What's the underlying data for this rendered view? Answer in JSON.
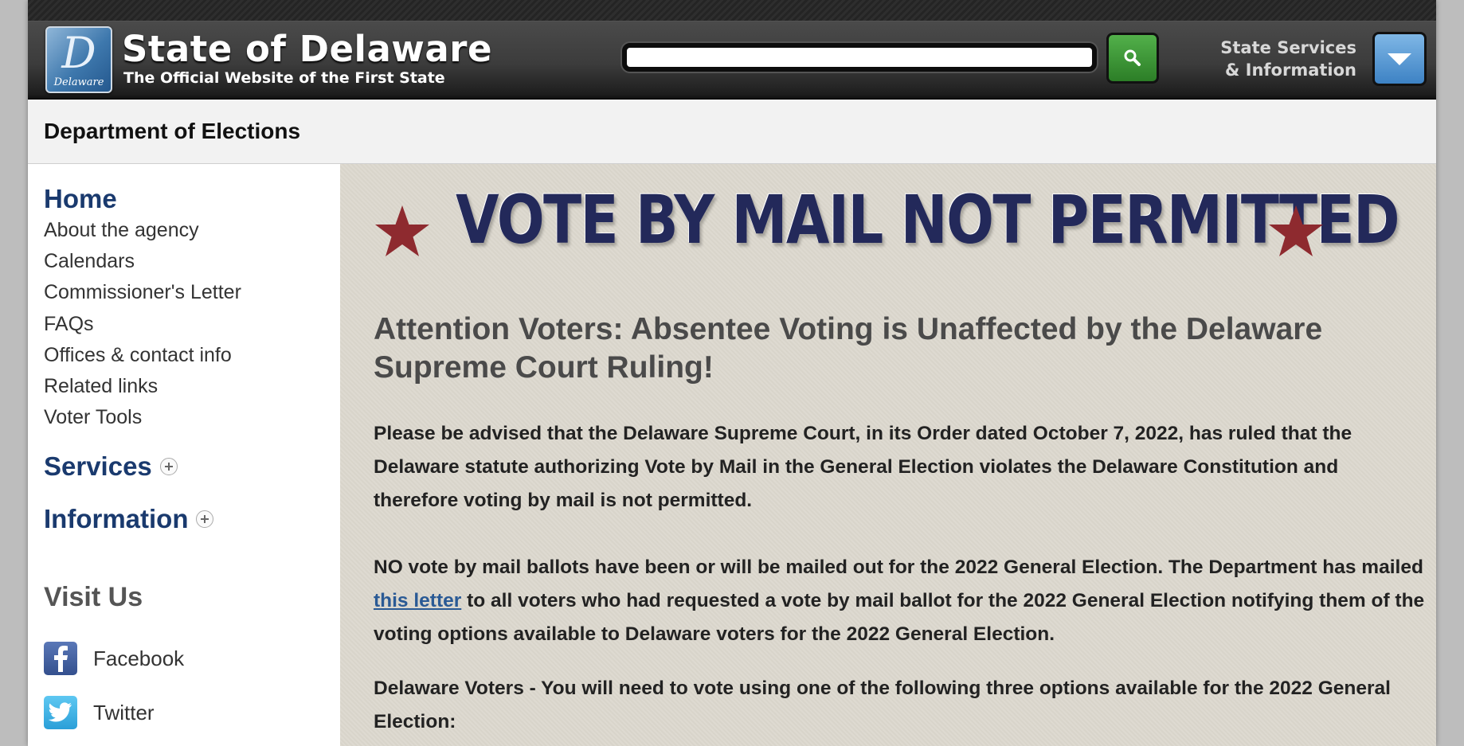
{
  "header": {
    "logo_letter": "D",
    "logo_caption": "Delaware",
    "site_title": "State of Delaware",
    "site_subtitle": "The Official Website of the First State",
    "search_placeholder": "",
    "services_line1": "State Services",
    "services_line2": "& Information"
  },
  "department": {
    "title": "Department of Elections"
  },
  "sidebar": {
    "home": "Home",
    "links": [
      "About the agency",
      "Calendars",
      "Commissioner's Letter",
      "FAQs",
      "Offices & contact info",
      "Related links",
      "Voter Tools"
    ],
    "sections": [
      "Services",
      "Information"
    ],
    "visit_heading": "Visit Us",
    "social": [
      "Facebook",
      "Twitter"
    ]
  },
  "main": {
    "banner": "VOTE BY MAIL NOT PERMITTED",
    "heading": "Attention Voters: Absentee Voting is Unaffected by the Delaware Supreme Court Ruling!",
    "para1": "Please be advised that the Delaware Supreme Court, in its Order dated October 7, 2022, has ruled that the Delaware statute authorizing Vote by Mail in the General Election violates the Delaware Constitution and therefore voting by mail is not permitted.",
    "para2_before": "NO vote by mail ballots have been or will be mailed out for the 2022 General Election. The Department has mailed ",
    "para2_link": "this letter",
    "para2_after": " to all voters who had requested a vote by mail ballot for the 2022 General Election notifying them of the voting options available to Delaware voters for the 2022 General Election.",
    "para3": "Delaware Voters - You will need to vote using one of the following three options available for the 2022 General Election:"
  },
  "colors": {
    "nav_blue": "#1a3a6e",
    "banner_navy": "#23295a",
    "star_red": "#8e2a2f",
    "search_green": "#3c9a36",
    "services_blue": "#4f94d2"
  }
}
